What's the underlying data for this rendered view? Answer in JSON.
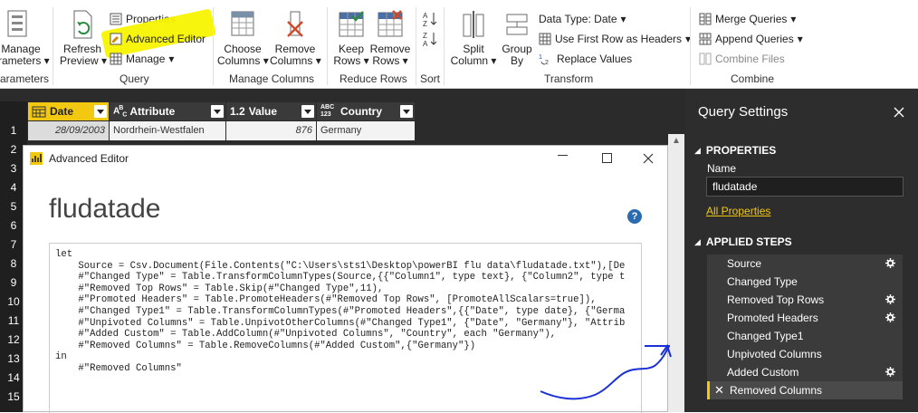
{
  "ribbon": {
    "parameters": {
      "manage_line1": "Manage",
      "manage_line2": "rameters",
      "group": "arameters"
    },
    "query": {
      "refresh_line1": "Refresh",
      "refresh_line2": "Preview",
      "properties": "Properties",
      "advanced_editor": "Advanced Editor",
      "manage": "Manage",
      "group": "Query"
    },
    "manage_columns": {
      "choose_line1": "Choose",
      "choose_line2": "Columns",
      "remove_line1": "Remove",
      "remove_line2": "Columns",
      "group": "Manage Columns"
    },
    "reduce_rows": {
      "keep_line1": "Keep",
      "keep_line2": "Rows",
      "remove_line1": "Remove",
      "remove_line2": "Rows",
      "group": "Reduce Rows"
    },
    "sort": {
      "group": "Sort"
    },
    "transform": {
      "split_line1": "Split",
      "split_line2": "Column",
      "group_line1": "Group",
      "group_line2": "By",
      "data_type": "Data Type: Date",
      "use_first_row": "Use First Row as Headers",
      "replace_values": "Replace Values",
      "group": "Transform"
    },
    "combine": {
      "merge": "Merge Queries",
      "append": "Append Queries",
      "combine_files": "Combine Files",
      "group": "Combine"
    },
    "highlight_color": "#f7f400"
  },
  "grid": {
    "columns": [
      {
        "type_icon": "calendar-icon",
        "name": "Date"
      },
      {
        "type_icon": "text-type-icon",
        "type_label": "A B C",
        "name": "Attribute"
      },
      {
        "type_label": "1.2",
        "name": "Value"
      },
      {
        "type_label": "ABC 123",
        "name": "Country"
      }
    ],
    "row1": {
      "date": "28/09/2003",
      "attribute": "Nordrhein-Westfalen",
      "value": "876",
      "country": "Germany"
    },
    "row_numbers": [
      "1",
      "2",
      "3",
      "4",
      "5",
      "6",
      "7",
      "8",
      "9",
      "10",
      "11",
      "12",
      "13",
      "14",
      "15"
    ]
  },
  "editor": {
    "window_title": "Advanced Editor",
    "query_name": "fludatade",
    "code": "let\n    Source = Csv.Document(File.Contents(\"C:\\Users\\sts1\\Desktop\\powerBI flu data\\fludatade.txt\"),[De\n    #\"Changed Type\" = Table.TransformColumnTypes(Source,{{\"Column1\", type text}, {\"Column2\", type t\n    #\"Removed Top Rows\" = Table.Skip(#\"Changed Type\",11),\n    #\"Promoted Headers\" = Table.PromoteHeaders(#\"Removed Top Rows\", [PromoteAllScalars=true]),\n    #\"Changed Type1\" = Table.TransformColumnTypes(#\"Promoted Headers\",{{\"Date\", type date}, {\"Germa\n    #\"Unpivoted Columns\" = Table.UnpivotOtherColumns(#\"Changed Type1\", {\"Date\", \"Germany\"}, \"Attrib\n    #\"Added Custom\" = Table.AddColumn(#\"Unpivoted Columns\", \"Country\", each \"Germany\"),\n    #\"Removed Columns\" = Table.RemoveColumns(#\"Added Custom\",{\"Germany\"})\nin\n    #\"Removed Columns\"",
    "help_glyph": "?"
  },
  "query_settings": {
    "title": "Query Settings",
    "properties_heading": "PROPERTIES",
    "name_label": "Name",
    "name_value": "fludatade",
    "all_properties": "All Properties",
    "applied_steps_heading": "APPLIED STEPS",
    "steps": [
      {
        "label": "Source",
        "gear": true
      },
      {
        "label": "Changed Type",
        "gear": false
      },
      {
        "label": "Removed Top Rows",
        "gear": true
      },
      {
        "label": "Promoted Headers",
        "gear": true
      },
      {
        "label": "Changed Type1",
        "gear": false
      },
      {
        "label": "Unpivoted Columns",
        "gear": false
      },
      {
        "label": "Added Custom",
        "gear": true
      },
      {
        "label": "Removed Columns",
        "gear": false,
        "selected": true
      }
    ],
    "accent_color": "#f2c811"
  },
  "annotation": {
    "ink_color": "#1a2fd6"
  }
}
